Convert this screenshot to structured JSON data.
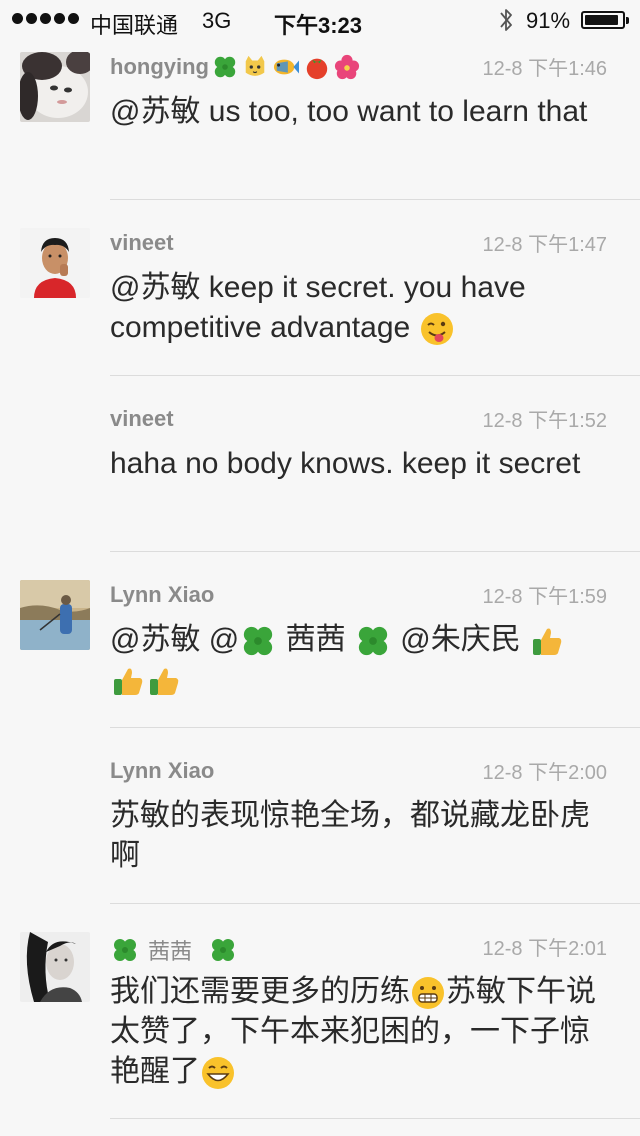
{
  "status_bar": {
    "carrier": "中国联通",
    "network": "3G",
    "time": "下午3:23",
    "battery_percent": "91%",
    "battery_level": 0.91
  },
  "comments": [
    {
      "author": "hongying",
      "author_emojis": [
        "four-leaf-clover-icon",
        "cat-face-icon",
        "tropical-fish-icon",
        "tomato-icon",
        "hibiscus-icon"
      ],
      "timestamp": "12-8 下午1:46",
      "text": "@苏敏 us too, too want to learn that",
      "has_avatar": true
    },
    {
      "author": "vineet",
      "timestamp": "12-8 下午1:47",
      "text": "@苏敏 keep it secret. you have competitive  advantage",
      "trailing_emoji": "winking-tongue-face-icon",
      "has_avatar": true
    },
    {
      "author": "vineet",
      "timestamp": "12-8 下午1:52",
      "text": "haha no body knows. keep it secret",
      "has_avatar": false
    },
    {
      "author": "Lynn Xiao",
      "timestamp": "12-8 下午1:59",
      "text_parts": [
        "@苏敏 @",
        " 茜茜 ",
        " @朱庆民 "
      ],
      "has_avatar": true
    },
    {
      "author": "Lynn Xiao",
      "timestamp": "12-8 下午2:00",
      "text": "苏敏的表现惊艳全场，都说藏龙卧虎啊",
      "has_avatar": false
    },
    {
      "author": "茜茜",
      "timestamp": "12-8 下午2:01",
      "text_parts": [
        "我们还需要更多的历练",
        "苏敏下午说太赞了，下午本来犯困的，一下子惊艳醒了"
      ],
      "has_avatar": true
    }
  ],
  "colors": {
    "background": "#f7f7f7",
    "author": "#8a8a8a",
    "timestamp": "#a9a9a9",
    "text": "#2a2a2a",
    "separator": "#dcdcdc"
  }
}
